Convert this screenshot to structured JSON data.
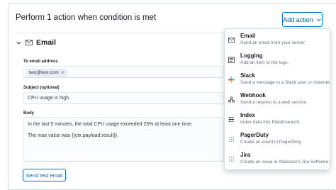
{
  "header": {
    "title": "Perform 1 action when condition is met",
    "add_action_label": "Add action"
  },
  "email": {
    "section_title": "Email",
    "to_label": "To email address",
    "to_chip": "test@test.com",
    "subject_label": "Subject (optional)",
    "subject_value": "CPU usage is high",
    "body_label": "Body",
    "body_line1": "In the last 5 minutes, the total CPU usage exceeded 25% at least one time.",
    "body_line2": "The max value was {{ctx.payload.result}}.",
    "send_test_label": "Send test email"
  },
  "menu": {
    "items": [
      {
        "title": "Email",
        "desc": "Send an email from your server.",
        "icon": "envelope-icon"
      },
      {
        "title": "Logging",
        "desc": "Add an item to the logs.",
        "icon": "logging-icon"
      },
      {
        "title": "Slack",
        "desc": "Send a message to a Slack user or channel.",
        "icon": "slack-icon"
      },
      {
        "title": "Webhook",
        "desc": "Send a request to a web service.",
        "icon": "webhook-icon"
      },
      {
        "title": "Index",
        "desc": "Index data into Elasticsearch.",
        "icon": "index-icon"
      },
      {
        "title": "PagerDuty",
        "desc": "Create an event in PagerDuty.",
        "icon": "pagerduty-icon"
      },
      {
        "title": "Jira",
        "desc": "Create an issue in Atlassian's Jira Software.",
        "icon": "jira-icon"
      }
    ]
  },
  "colors": {
    "accent": "#0077cc",
    "border": "#d3dae6",
    "muted_text": "#69707d"
  }
}
